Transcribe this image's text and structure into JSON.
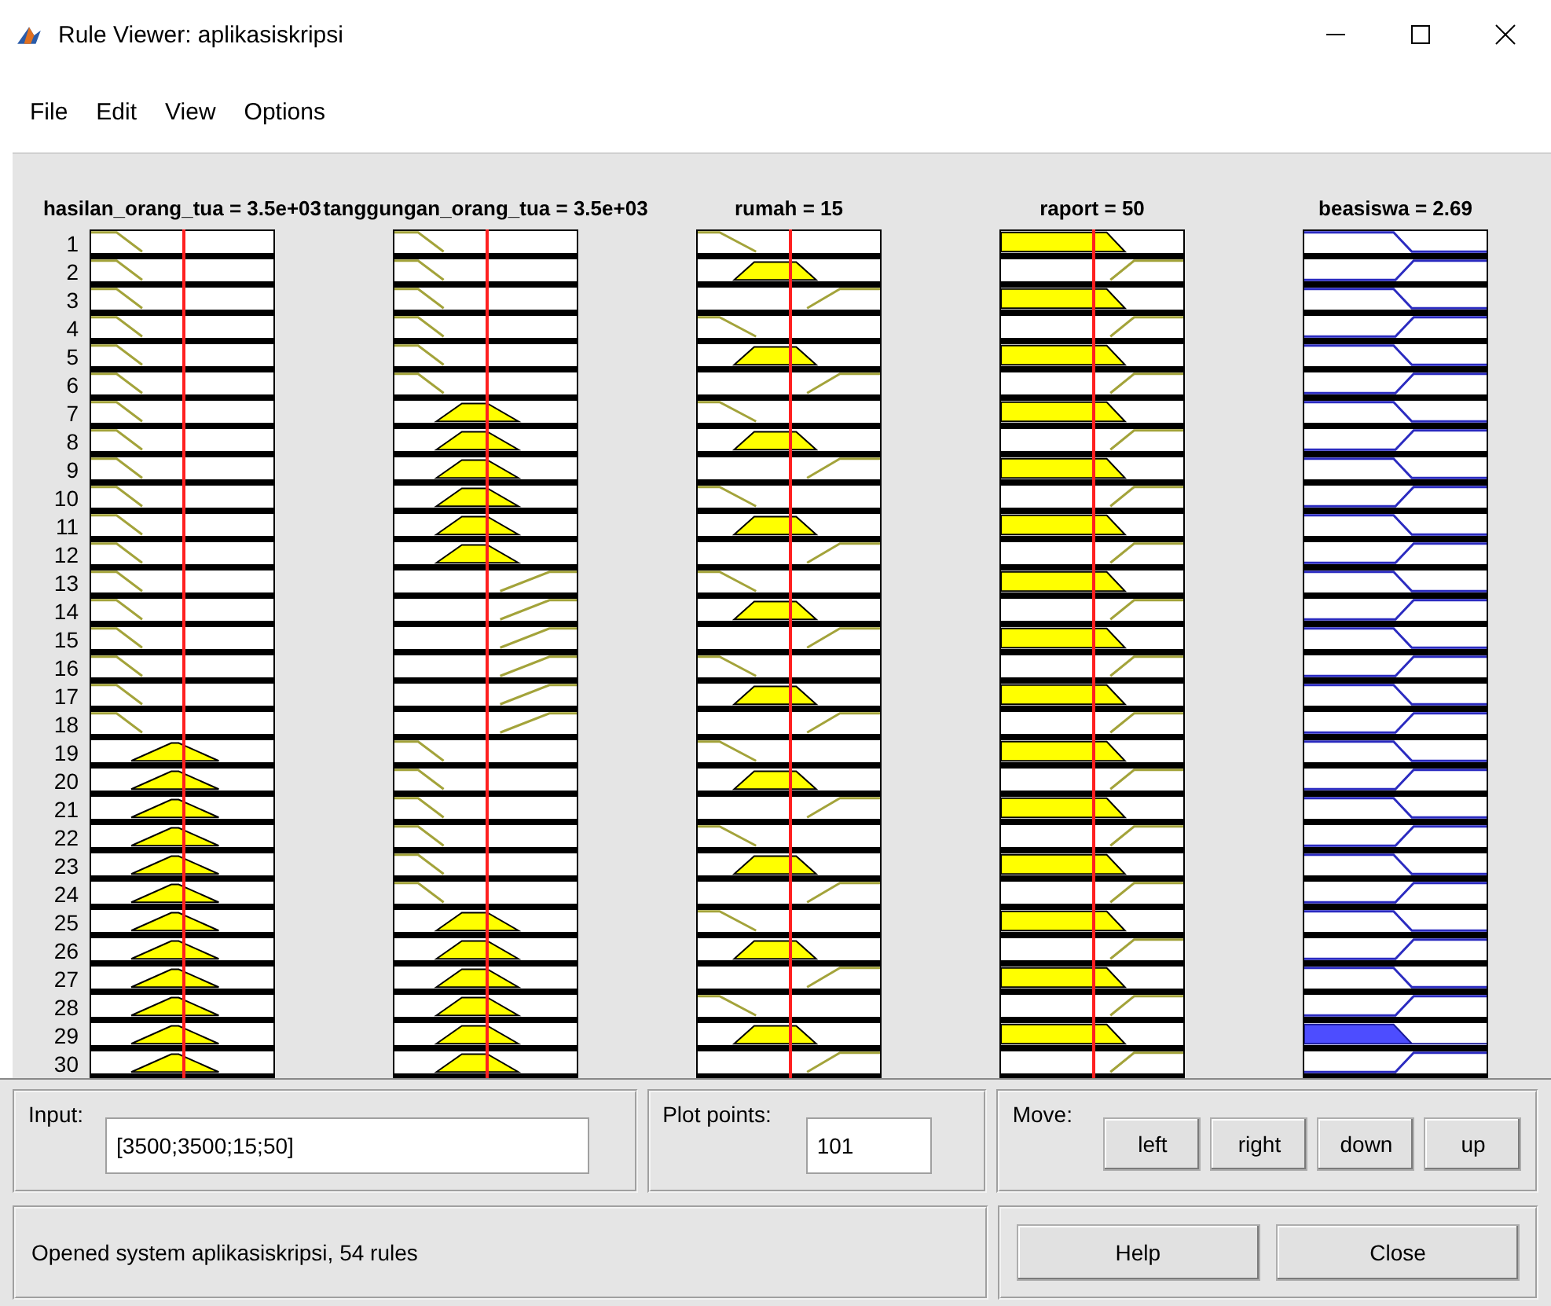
{
  "window": {
    "title": "Rule Viewer: aplikasiskripsi"
  },
  "menu": [
    "File",
    "Edit",
    "View",
    "Options"
  ],
  "columns": [
    {
      "title": "hasilan_orang_tua = 3.5e+03",
      "kind": "input"
    },
    {
      "title": "tanggungan_orang_tua = 3.5e+03",
      "kind": "input"
    },
    {
      "title": "rumah = 15",
      "kind": "input"
    },
    {
      "title": "raport = 50",
      "kind": "input"
    },
    {
      "title": "beasiswa = 2.69",
      "kind": "output"
    }
  ],
  "rules": [
    {
      "number": "1",
      "cells": [
        {
          "kind": "low",
          "fired": false
        },
        {
          "kind": "low",
          "fired": false
        },
        {
          "kind": "low",
          "fired": false
        },
        {
          "kind": "low",
          "fired": true
        },
        {
          "kind": "low",
          "fired": false
        }
      ]
    },
    {
      "number": "2",
      "cells": [
        {
          "kind": "low",
          "fired": false
        },
        {
          "kind": "low",
          "fired": false
        },
        {
          "kind": "mid",
          "fired": true
        },
        {
          "kind": "high",
          "fired": false
        },
        {
          "kind": "high",
          "fired": false
        }
      ]
    },
    {
      "number": "3",
      "cells": [
        {
          "kind": "low",
          "fired": false
        },
        {
          "kind": "low",
          "fired": false
        },
        {
          "kind": "high",
          "fired": false
        },
        {
          "kind": "low",
          "fired": true
        },
        {
          "kind": "low",
          "fired": false
        }
      ]
    },
    {
      "number": "4",
      "cells": [
        {
          "kind": "low",
          "fired": false
        },
        {
          "kind": "low",
          "fired": false
        },
        {
          "kind": "low",
          "fired": false
        },
        {
          "kind": "high",
          "fired": false
        },
        {
          "kind": "high",
          "fired": false
        }
      ]
    },
    {
      "number": "5",
      "cells": [
        {
          "kind": "low",
          "fired": false
        },
        {
          "kind": "low",
          "fired": false
        },
        {
          "kind": "mid",
          "fired": true
        },
        {
          "kind": "low",
          "fired": true
        },
        {
          "kind": "low",
          "fired": false
        }
      ]
    },
    {
      "number": "6",
      "cells": [
        {
          "kind": "low",
          "fired": false
        },
        {
          "kind": "low",
          "fired": false
        },
        {
          "kind": "high",
          "fired": false
        },
        {
          "kind": "high",
          "fired": false
        },
        {
          "kind": "high",
          "fired": false
        }
      ]
    },
    {
      "number": "7",
      "cells": [
        {
          "kind": "low",
          "fired": false
        },
        {
          "kind": "mid",
          "fired": true
        },
        {
          "kind": "low",
          "fired": false
        },
        {
          "kind": "low",
          "fired": true
        },
        {
          "kind": "low",
          "fired": false
        }
      ]
    },
    {
      "number": "8",
      "cells": [
        {
          "kind": "low",
          "fired": false
        },
        {
          "kind": "mid",
          "fired": true
        },
        {
          "kind": "mid",
          "fired": true
        },
        {
          "kind": "high",
          "fired": false
        },
        {
          "kind": "high",
          "fired": false
        }
      ]
    },
    {
      "number": "9",
      "cells": [
        {
          "kind": "low",
          "fired": false
        },
        {
          "kind": "mid",
          "fired": true
        },
        {
          "kind": "high",
          "fired": false
        },
        {
          "kind": "low",
          "fired": true
        },
        {
          "kind": "low",
          "fired": false
        }
      ]
    },
    {
      "number": "10",
      "cells": [
        {
          "kind": "low",
          "fired": false
        },
        {
          "kind": "mid",
          "fired": true
        },
        {
          "kind": "low",
          "fired": false
        },
        {
          "kind": "high",
          "fired": false
        },
        {
          "kind": "high",
          "fired": false
        }
      ]
    },
    {
      "number": "11",
      "cells": [
        {
          "kind": "low",
          "fired": false
        },
        {
          "kind": "mid",
          "fired": true
        },
        {
          "kind": "mid",
          "fired": true
        },
        {
          "kind": "low",
          "fired": true
        },
        {
          "kind": "low",
          "fired": false
        }
      ]
    },
    {
      "number": "12",
      "cells": [
        {
          "kind": "low",
          "fired": false
        },
        {
          "kind": "mid",
          "fired": true
        },
        {
          "kind": "high",
          "fired": false
        },
        {
          "kind": "high",
          "fired": false
        },
        {
          "kind": "high",
          "fired": false
        }
      ]
    },
    {
      "number": "13",
      "cells": [
        {
          "kind": "low",
          "fired": false
        },
        {
          "kind": "high",
          "fired": false
        },
        {
          "kind": "low",
          "fired": false
        },
        {
          "kind": "low",
          "fired": true
        },
        {
          "kind": "low",
          "fired": false
        }
      ]
    },
    {
      "number": "14",
      "cells": [
        {
          "kind": "low",
          "fired": false
        },
        {
          "kind": "high",
          "fired": false
        },
        {
          "kind": "mid",
          "fired": true
        },
        {
          "kind": "high",
          "fired": false
        },
        {
          "kind": "high",
          "fired": false
        }
      ]
    },
    {
      "number": "15",
      "cells": [
        {
          "kind": "low",
          "fired": false
        },
        {
          "kind": "high",
          "fired": false
        },
        {
          "kind": "high",
          "fired": false
        },
        {
          "kind": "low",
          "fired": true
        },
        {
          "kind": "low",
          "fired": false
        }
      ]
    },
    {
      "number": "16",
      "cells": [
        {
          "kind": "low",
          "fired": false
        },
        {
          "kind": "high",
          "fired": false
        },
        {
          "kind": "low",
          "fired": false
        },
        {
          "kind": "high",
          "fired": false
        },
        {
          "kind": "high",
          "fired": false
        }
      ]
    },
    {
      "number": "17",
      "cells": [
        {
          "kind": "low",
          "fired": false
        },
        {
          "kind": "high",
          "fired": false
        },
        {
          "kind": "mid",
          "fired": true
        },
        {
          "kind": "low",
          "fired": true
        },
        {
          "kind": "low",
          "fired": false
        }
      ]
    },
    {
      "number": "18",
      "cells": [
        {
          "kind": "low",
          "fired": false
        },
        {
          "kind": "high",
          "fired": false
        },
        {
          "kind": "high",
          "fired": false
        },
        {
          "kind": "high",
          "fired": false
        },
        {
          "kind": "high",
          "fired": false
        }
      ]
    },
    {
      "number": "19",
      "cells": [
        {
          "kind": "mid",
          "fired": true
        },
        {
          "kind": "low",
          "fired": false
        },
        {
          "kind": "low",
          "fired": false
        },
        {
          "kind": "low",
          "fired": true
        },
        {
          "kind": "low",
          "fired": false
        }
      ]
    },
    {
      "number": "20",
      "cells": [
        {
          "kind": "mid",
          "fired": true
        },
        {
          "kind": "low",
          "fired": false
        },
        {
          "kind": "mid",
          "fired": true
        },
        {
          "kind": "high",
          "fired": false
        },
        {
          "kind": "high",
          "fired": false
        }
      ]
    },
    {
      "number": "21",
      "cells": [
        {
          "kind": "mid",
          "fired": true
        },
        {
          "kind": "low",
          "fired": false
        },
        {
          "kind": "high",
          "fired": false
        },
        {
          "kind": "low",
          "fired": true
        },
        {
          "kind": "low",
          "fired": false
        }
      ]
    },
    {
      "number": "22",
      "cells": [
        {
          "kind": "mid",
          "fired": true
        },
        {
          "kind": "low",
          "fired": false
        },
        {
          "kind": "low",
          "fired": false
        },
        {
          "kind": "high",
          "fired": false
        },
        {
          "kind": "high",
          "fired": false
        }
      ]
    },
    {
      "number": "23",
      "cells": [
        {
          "kind": "mid",
          "fired": true
        },
        {
          "kind": "low",
          "fired": false
        },
        {
          "kind": "mid",
          "fired": true
        },
        {
          "kind": "low",
          "fired": true
        },
        {
          "kind": "low",
          "fired": false
        }
      ]
    },
    {
      "number": "24",
      "cells": [
        {
          "kind": "mid",
          "fired": true
        },
        {
          "kind": "low",
          "fired": false
        },
        {
          "kind": "high",
          "fired": false
        },
        {
          "kind": "high",
          "fired": false
        },
        {
          "kind": "high",
          "fired": false
        }
      ]
    },
    {
      "number": "25",
      "cells": [
        {
          "kind": "mid",
          "fired": true
        },
        {
          "kind": "mid",
          "fired": true
        },
        {
          "kind": "low",
          "fired": false
        },
        {
          "kind": "low",
          "fired": true
        },
        {
          "kind": "low",
          "fired": false
        }
      ]
    },
    {
      "number": "26",
      "cells": [
        {
          "kind": "mid",
          "fired": true
        },
        {
          "kind": "mid",
          "fired": true
        },
        {
          "kind": "mid",
          "fired": true
        },
        {
          "kind": "high",
          "fired": false
        },
        {
          "kind": "high",
          "fired": false
        }
      ]
    },
    {
      "number": "27",
      "cells": [
        {
          "kind": "mid",
          "fired": true
        },
        {
          "kind": "mid",
          "fired": true
        },
        {
          "kind": "high",
          "fired": false
        },
        {
          "kind": "low",
          "fired": true
        },
        {
          "kind": "low",
          "fired": false
        }
      ]
    },
    {
      "number": "28",
      "cells": [
        {
          "kind": "mid",
          "fired": true
        },
        {
          "kind": "mid",
          "fired": true
        },
        {
          "kind": "low",
          "fired": false
        },
        {
          "kind": "high",
          "fired": false
        },
        {
          "kind": "high",
          "fired": false
        }
      ]
    },
    {
      "number": "29",
      "cells": [
        {
          "kind": "mid",
          "fired": true
        },
        {
          "kind": "mid",
          "fired": true
        },
        {
          "kind": "mid",
          "fired": true
        },
        {
          "kind": "low",
          "fired": true
        },
        {
          "kind": "low",
          "fired": true
        }
      ]
    },
    {
      "number": "30",
      "cells": [
        {
          "kind": "mid",
          "fired": true
        },
        {
          "kind": "mid",
          "fired": true
        },
        {
          "kind": "high",
          "fired": false
        },
        {
          "kind": "high",
          "fired": false
        },
        {
          "kind": "high",
          "fired": false
        }
      ]
    }
  ],
  "input": {
    "label": "Input:",
    "value": "[3500;3500;15;50]"
  },
  "plot_points": {
    "label": "Plot points:",
    "value": "101"
  },
  "move": {
    "label": "Move:",
    "buttons": [
      "left",
      "right",
      "down",
      "up"
    ]
  },
  "status": "Opened system aplikasiskripsi, 54 rules",
  "buttons": [
    "Help",
    "Close"
  ]
}
